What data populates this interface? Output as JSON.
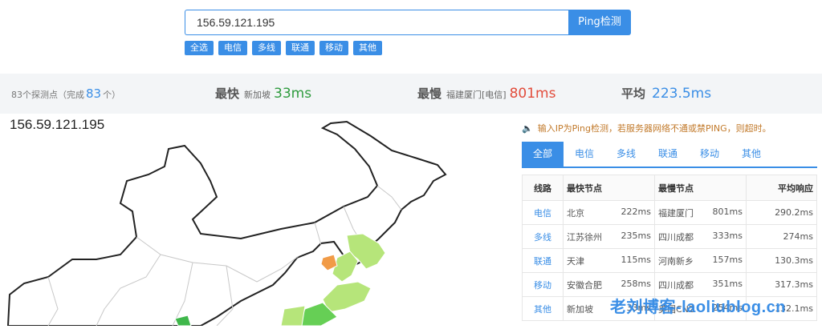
{
  "search": {
    "ip_value": "156.59.121.195",
    "button_label": "Ping检测"
  },
  "filters": [
    "全选",
    "电信",
    "多线",
    "联通",
    "移动",
    "其他"
  ],
  "stats": {
    "probes_prefix": "83个探测点（完成",
    "probes_done": "83",
    "probes_suffix": "个）",
    "fastest_label": "最快",
    "fastest_node": "新加坡",
    "fastest_value": "33ms",
    "slowest_label": "最慢",
    "slowest_node": "福建厦门[电信]",
    "slowest_value": "801ms",
    "avg_label": "平均",
    "avg_value": "223.5ms"
  },
  "map": {
    "ip_title": "156.59.121.195"
  },
  "notice": "输入IP为Ping检测，若服务器网络不通或禁PING，则超时。",
  "tabs": [
    "全部",
    "电信",
    "多线",
    "联通",
    "移动",
    "其他"
  ],
  "table": {
    "headers": [
      "线路",
      "最快节点",
      "最慢节点",
      "平均响应"
    ],
    "rows": [
      {
        "line": "电信",
        "fast_node": "北京",
        "fast_ms": "222ms",
        "slow_node": "福建厦门",
        "slow_ms": "801ms",
        "avg": "290.2ms"
      },
      {
        "line": "多线",
        "fast_node": "江苏徐州",
        "fast_ms": "235ms",
        "slow_node": "四川成都",
        "slow_ms": "333ms",
        "avg": "274ms"
      },
      {
        "line": "联通",
        "fast_node": "天津",
        "fast_ms": "115ms",
        "slow_node": "河南新乡",
        "slow_ms": "157ms",
        "avg": "130.3ms"
      },
      {
        "line": "移动",
        "fast_node": "安徽合肥",
        "fast_ms": "258ms",
        "slow_node": "四川成都",
        "slow_ms": "351ms",
        "avg": "317.3ms"
      },
      {
        "line": "其他",
        "fast_node": "新加坡",
        "fast_ms": "33ms",
        "slow_node": "美国CN2",
        "slow_ms": "254ms",
        "avg": "132.1ms"
      }
    ]
  },
  "watermark": "老刘博客-laoliublog.cn",
  "colors": {
    "accent": "#3a8ee6",
    "fast": "#2e9b3e",
    "slow": "#e24c3b",
    "notice": "#c27a2b"
  }
}
